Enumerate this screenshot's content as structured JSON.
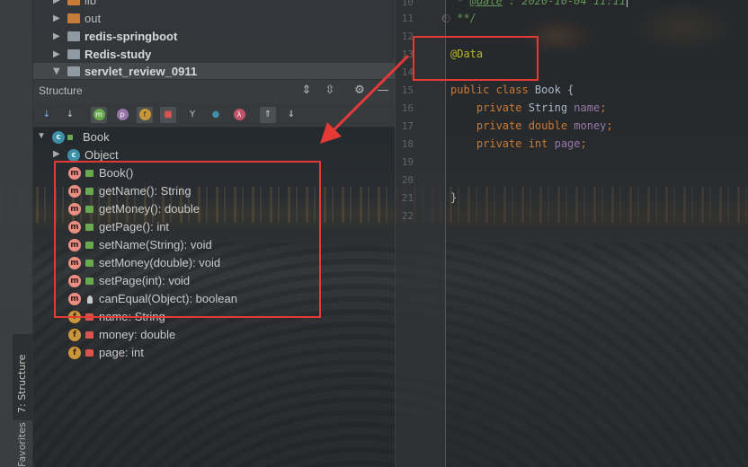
{
  "project_tree": {
    "items": [
      {
        "name": "lib",
        "bold": false,
        "expanded": false,
        "folder_color": "#c77c3a"
      },
      {
        "name": "out",
        "bold": false,
        "expanded": false,
        "folder_color": "#c77c3a"
      },
      {
        "name": "redis-springboot",
        "bold": true,
        "expanded": false,
        "folder_color": "#8f9aa3"
      },
      {
        "name": "Redis-study",
        "bold": true,
        "expanded": false,
        "folder_color": "#8f9aa3"
      },
      {
        "name": "servlet_review_0911",
        "bold": true,
        "expanded": true,
        "folder_color": "#8f9aa3"
      }
    ]
  },
  "structure_panel": {
    "title": "Structure",
    "header_icons": [
      "expand-all-icon",
      "collapse-all-icon",
      "gear-icon",
      "hide-icon"
    ],
    "toolbar_icons": [
      "sort-by-visibility-icon",
      "sort-alphabetically-icon",
      "show-inherited-icon",
      "show-properties-icon",
      "show-fields-icon",
      "show-non-public-icon",
      "show-inherited-members-icon",
      "show-anonymous-icon",
      "show-lambdas-icon",
      "autoscroll-to-source-icon",
      "autoscroll-from-source-icon"
    ],
    "toolbar_glyphs": [
      "↓",
      "↓",
      "m",
      "p",
      "f",
      "■",
      "Y",
      "●",
      "λ",
      "⇑",
      "⇓"
    ],
    "class_badge": "c",
    "class_name": "Book",
    "object_badge": "c",
    "object_name": "Object",
    "members": [
      {
        "kind": "m",
        "visibility": "public",
        "label": "Book()"
      },
      {
        "kind": "m",
        "visibility": "public",
        "label": "getName(): String"
      },
      {
        "kind": "m",
        "visibility": "public",
        "label": "getMoney(): double"
      },
      {
        "kind": "m",
        "visibility": "public",
        "label": "getPage(): int"
      },
      {
        "kind": "m",
        "visibility": "public",
        "label": "setName(String): void"
      },
      {
        "kind": "m",
        "visibility": "public",
        "label": "setMoney(double): void"
      },
      {
        "kind": "m",
        "visibility": "public",
        "label": "setPage(int): void"
      },
      {
        "kind": "m",
        "visibility": "protected",
        "label": "canEqual(Object): boolean"
      },
      {
        "kind": "f",
        "visibility": "private",
        "label": "name: String"
      },
      {
        "kind": "f",
        "visibility": "private",
        "label": "money: double"
      },
      {
        "kind": "f",
        "visibility": "private",
        "label": "page: int"
      }
    ]
  },
  "side_tabs": {
    "structure": "7: Structure",
    "favorites": "Favorites"
  },
  "editor": {
    "line_numbers": [
      "10",
      "11",
      "12",
      "13",
      "14",
      "15",
      "16",
      "17",
      "18",
      "19",
      "20",
      "21",
      "22"
    ],
    "lines": {
      "l10_prefix": " * ",
      "l10_tag": "@date",
      "l10_rest": " : 2020-10-04 11:11",
      "l11": " **/",
      "l13": "@Data",
      "l15_kw1": "public class",
      "l15_rest": " Book {",
      "l16_kw": "    private",
      "l16_type": " String ",
      "l16_field": "name",
      "l16_end": ";",
      "l17_kw": "    private double",
      "l17_sp": " ",
      "l17_field": "money",
      "l17_end": ";",
      "l18_kw": "    private int",
      "l18_sp": " ",
      "l18_field": "page",
      "l18_end": ";",
      "l21": "}"
    }
  },
  "colors": {
    "annotation_red": "#e53935",
    "keyword": "#cc7832",
    "annotation": "#bbb529",
    "field": "#9876aa",
    "comment": "#629755"
  }
}
